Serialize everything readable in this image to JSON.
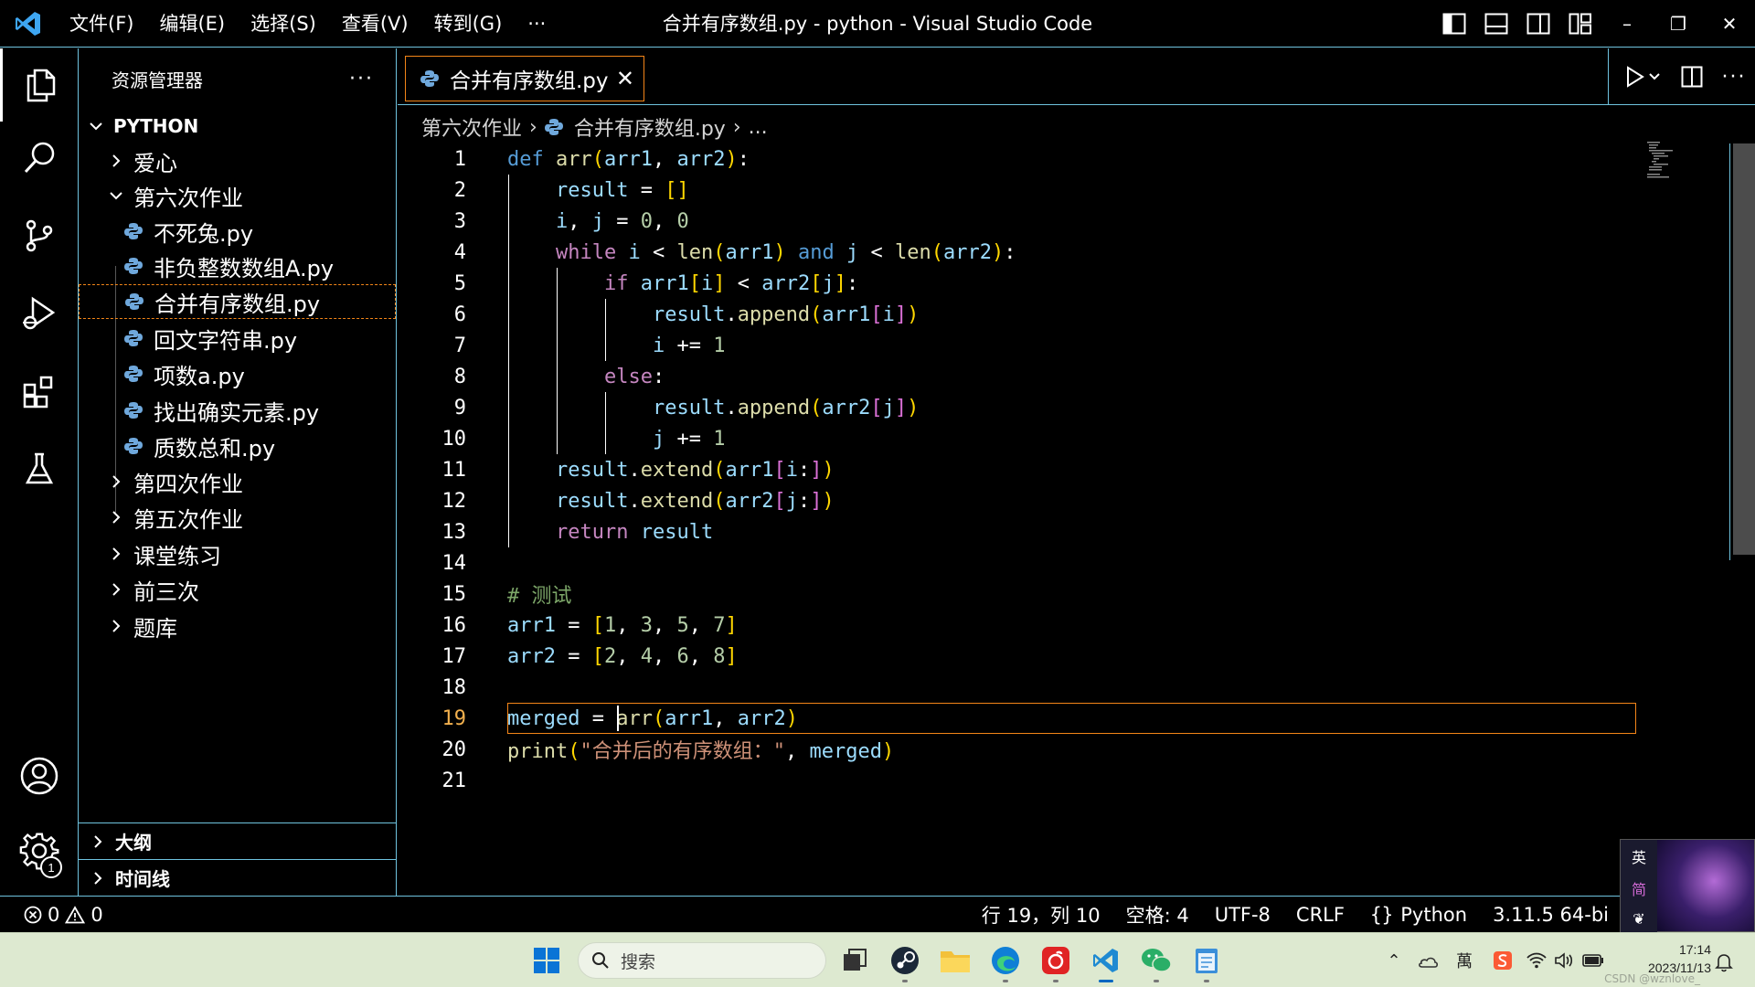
{
  "app": {
    "window_title": "合并有序数组.py - python - Visual Studio Code",
    "menu": [
      "文件(F)",
      "编辑(E)",
      "选择(S)",
      "查看(V)",
      "转到(G)",
      "···"
    ]
  },
  "window_controls": {
    "minimize": "–",
    "restore": "❐",
    "close": "✕"
  },
  "sidebar": {
    "title": "资源管理器",
    "more": "···",
    "root": "PYTHON",
    "tree": [
      {
        "label": "爱心",
        "type": "folder",
        "expanded": false,
        "level": 1
      },
      {
        "label": "第六次作业",
        "type": "folder",
        "expanded": true,
        "level": 1
      },
      {
        "label": "不死兔.py",
        "type": "file",
        "level": 2
      },
      {
        "label": "非负整数数组A.py",
        "type": "file",
        "level": 2
      },
      {
        "label": "合并有序数组.py",
        "type": "file",
        "level": 2,
        "selected": true
      },
      {
        "label": "回文字符串.py",
        "type": "file",
        "level": 2
      },
      {
        "label": "项数a.py",
        "type": "file",
        "level": 2
      },
      {
        "label": "找出确实元素.py",
        "type": "file",
        "level": 2
      },
      {
        "label": "质数总和.py",
        "type": "file",
        "level": 2
      },
      {
        "label": "第四次作业",
        "type": "folder",
        "expanded": false,
        "level": 1
      },
      {
        "label": "第五次作业",
        "type": "folder",
        "expanded": false,
        "level": 1
      },
      {
        "label": "课堂练习",
        "type": "folder",
        "expanded": false,
        "level": 1
      },
      {
        "label": "前三次",
        "type": "folder",
        "expanded": false,
        "level": 1
      },
      {
        "label": "题库",
        "type": "folder",
        "expanded": false,
        "level": 1
      }
    ],
    "outline": "大纲",
    "timeline": "时间线"
  },
  "activity_bar": {
    "items": [
      "explorer-icon",
      "search-icon",
      "source-control-icon",
      "run-debug-icon",
      "extensions-icon",
      "testing-icon"
    ],
    "accounts": "account-icon",
    "settings_badge": "1"
  },
  "editor": {
    "tab": {
      "label": "合并有序数组.py",
      "close": "✕"
    },
    "breadcrumb": [
      "第六次作业",
      "合并有序数组.py",
      "..."
    ],
    "current_line": 19,
    "lines": [
      "def arr(arr1, arr2):",
      "    result = []",
      "    i, j = 0, 0",
      "    while i < len(arr1) and j < len(arr2):",
      "        if arr1[i] < arr2[j]:",
      "            result.append(arr1[i])",
      "            i += 1",
      "        else:",
      "            result.append(arr2[j])",
      "            j += 1",
      "    result.extend(arr1[i:])",
      "    result.extend(arr2[j:])",
      "    return result",
      "",
      "# 测试",
      "arr1 = [1, 3, 5, 7]",
      "arr2 = [2, 4, 6, 8]",
      "",
      "merged = arr(arr1, arr2)",
      "print(\"合并后的有序数组：\", merged)",
      ""
    ]
  },
  "status_bar": {
    "errors": "0",
    "warnings": "0",
    "position": "行 19，列 10",
    "spaces": "空格: 4",
    "encoding": "UTF-8",
    "eol": "CRLF",
    "language": "Python",
    "interpreter": "3.11.5 64-bi"
  },
  "ime": {
    "lang": "英",
    "mode": "简"
  },
  "taskbar": {
    "search_placeholder": "搜索",
    "tray_ime": "萬",
    "time": "17:14",
    "date": "2023/11/13",
    "watermark": "CSDN @wznlove_"
  },
  "colors": {
    "accent_border": "#6fc3df",
    "focus_border": "#f38518",
    "keyword": "#569cd6",
    "control_keyword": "#c586c0",
    "function": "#dcdcaa",
    "variable": "#9cdcfe",
    "number": "#b5cea8",
    "string": "#ce9178",
    "comment": "#7ca668"
  }
}
